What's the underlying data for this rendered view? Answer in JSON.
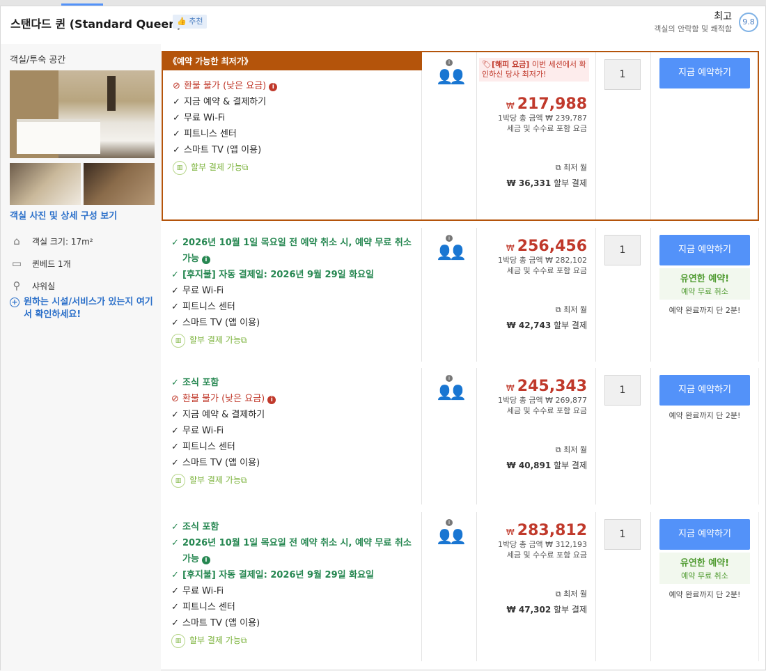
{
  "header": {
    "room_title": "스탠다드 퀸 (Standard Queen)",
    "recommend_badge": "추천",
    "score_word": "최고",
    "score_sub": "객실의 안락함 및 쾌적함",
    "score_value": "9.8"
  },
  "sidebar": {
    "space_label": "객실/투숙 공간",
    "photo_link": "객실 사진 및 상세 구성 보기",
    "features": [
      {
        "icon": "house-icon",
        "label": "객실 크기: 17m²"
      },
      {
        "icon": "bed-icon",
        "label": "퀸베드 1개"
      },
      {
        "icon": "shower-icon",
        "label": "샤워실"
      }
    ],
    "facility_link": "원하는 시설/서비스가 있는지 여기서 확인하세요!"
  },
  "common": {
    "installment": "할부 결제 가능",
    "book_label": "지금 예약하기",
    "price_sub_per_night_prefix": "1박당 총 금액 ₩",
    "price_sub_tax": "세금 및 수수료 포함 요금",
    "lowest_month": "최저 월",
    "monthly_suffix": "할부 결제",
    "currency": "₩",
    "flex_title": "유연한 예약!",
    "flex_sub": "예약 무료 취소",
    "finish": "예약 완료까지 단 2분!",
    "check": "✓",
    "no_icon": "⊘"
  },
  "offers": [
    {
      "banner": "《예약 가능한 최저가》",
      "promo_tag": "[해피 요금]",
      "promo_text": " 이번 세션에서 확인하신 당사 최저가!",
      "conditions": [
        {
          "kind": "red",
          "text": "환불 불가 (낮은 요금)",
          "info": true
        },
        {
          "kind": "plain",
          "text": "지금 예약 & 결제하기"
        },
        {
          "kind": "plain",
          "text": "무료 Wi-Fi"
        },
        {
          "kind": "plain",
          "text": "피트니스 센터"
        },
        {
          "kind": "plain",
          "text": "스마트 TV (앱 이용)"
        }
      ],
      "price": "217,988",
      "total": "239,787",
      "monthly": "₩ 36,331",
      "qty": "1",
      "flexible": false
    },
    {
      "conditions": [
        {
          "kind": "green",
          "text": "2026년 10월 1일 목요일 전 예약 취소 시, 예약 무료 취소 가능",
          "info": true
        },
        {
          "kind": "green",
          "text": "[후지불] 자동 결제일: 2026년 9월 29일 화요일"
        },
        {
          "kind": "plain",
          "text": "무료 Wi-Fi"
        },
        {
          "kind": "plain",
          "text": "피트니스 센터"
        },
        {
          "kind": "plain",
          "text": "스마트 TV (앱 이용)"
        }
      ],
      "price": "256,456",
      "total": "282,102",
      "monthly": "₩ 42,743",
      "qty": "1",
      "flexible": true
    },
    {
      "conditions": [
        {
          "kind": "green",
          "text": "조식 포함"
        },
        {
          "kind": "red",
          "text": "환불 불가 (낮은 요금)",
          "info": true
        },
        {
          "kind": "plain",
          "text": "지금 예약 & 결제하기"
        },
        {
          "kind": "plain",
          "text": "무료 Wi-Fi"
        },
        {
          "kind": "plain",
          "text": "피트니스 센터"
        },
        {
          "kind": "plain",
          "text": "스마트 TV (앱 이용)"
        }
      ],
      "price": "245,343",
      "total": "269,877",
      "monthly": "₩ 40,891",
      "qty": "1",
      "flexible": false
    },
    {
      "conditions": [
        {
          "kind": "green",
          "text": "조식 포함"
        },
        {
          "kind": "green",
          "text": "2026년 10월 1일 목요일 전 예약 취소 시, 예약 무료 취소 가능",
          "info": true
        },
        {
          "kind": "green",
          "text": "[후지불] 자동 결제일: 2026년 9월 29일 화요일"
        },
        {
          "kind": "plain",
          "text": "무료 Wi-Fi"
        },
        {
          "kind": "plain",
          "text": "피트니스 센터"
        },
        {
          "kind": "plain",
          "text": "스마트 TV (앱 이용)"
        }
      ],
      "price": "283,812",
      "total": "312,193",
      "monthly": "₩ 47,302",
      "qty": "1",
      "flexible": true
    }
  ],
  "colors": {
    "accent": "#5392f9",
    "price_red": "#c0392b",
    "best_orange": "#b4540b",
    "green": "#268751"
  }
}
